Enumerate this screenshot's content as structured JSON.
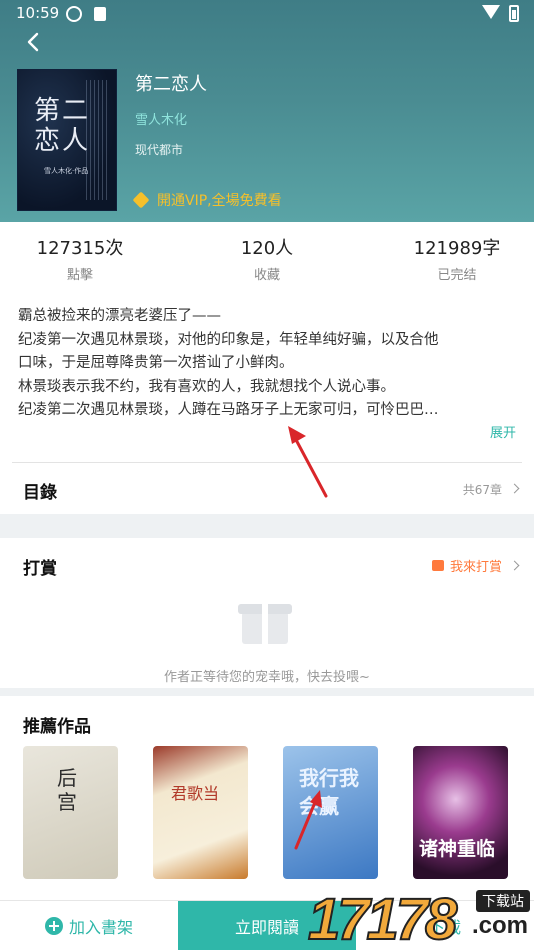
{
  "status_bar": {
    "time": "10:59"
  },
  "book": {
    "title": "第二恋人",
    "author": "雪人木化",
    "genre": "现代都市",
    "vip_promo": "開通VIP,全場免費看",
    "cover_title": "第二恋人",
    "cover_subtitle": "雪人木化·作品"
  },
  "stats": [
    {
      "value": "127315次",
      "label": "點擊"
    },
    {
      "value": "120人",
      "label": "收藏"
    },
    {
      "value": "121989字",
      "label": "已完结"
    }
  ],
  "description": {
    "lines": [
      "霸总被捡来的漂亮老婆压了——",
      "纪凌第一次遇见林景琰，对他的印象是，年轻单纯好骗，以及合他",
      "口味，于是屈尊降贵第一次搭讪了小鲜肉。",
      "林景琰表示我不约，我有喜欢的人，我就想找个人说心事。",
      "纪凌第二次遇见林景琰，人蹲在马路牙子上无家可归，可怜巴巴…"
    ],
    "expand_label": "展开"
  },
  "toc": {
    "title": "目錄",
    "count": "共67章"
  },
  "reward": {
    "title": "打賞",
    "action_label": "我來打賞",
    "empty_text": "作者正等待您的宠幸哦，快去投喂~"
  },
  "recommend": {
    "title": "推薦作品",
    "covers": [
      {
        "text": "后宫"
      },
      {
        "text": "君歌当"
      },
      {
        "text": "我行我会赢"
      },
      {
        "text": "诸神重临"
      }
    ]
  },
  "bottom_bar": {
    "add_shelf": "加入書架",
    "read_now": "立即閱讀",
    "third": "下載"
  },
  "watermark": {
    "digits": "17178",
    "tag": "下载站",
    "domain": ".com"
  },
  "colors": {
    "accent": "#2fb7a9",
    "header": "#4a8c92",
    "vip": "#f6c02a",
    "reward": "#ff7a3d",
    "arrow": "#d9262a"
  }
}
